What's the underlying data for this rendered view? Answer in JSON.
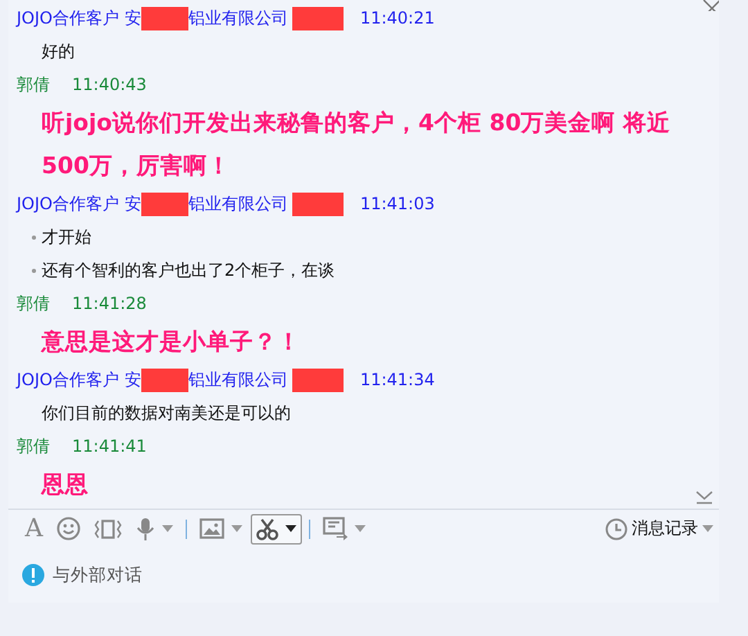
{
  "messages": [
    {
      "kind": "customer",
      "sender": "JOJO合作客户",
      "company_prefix": "安",
      "company_suffix": "铝业有限公司",
      "time": "11:40:21",
      "lines": [
        {
          "text": "好的",
          "bullet": false
        }
      ]
    },
    {
      "kind": "self",
      "sender": "郭倩",
      "time": "11:40:43",
      "lines": [
        {
          "text": "听jojo说你们开发出来秘鲁的客户，4个柜 80万美金啊  将近",
          "bullet": false
        },
        {
          "text": "500万，厉害啊！",
          "bullet": false
        }
      ]
    },
    {
      "kind": "customer",
      "sender": "JOJO合作客户",
      "company_prefix": "安",
      "company_suffix": "铝业有限公司",
      "time": "11:41:03",
      "lines": [
        {
          "text": "才开始",
          "bullet": true
        },
        {
          "text": "还有个智利的客户也出了2个柜子，在谈",
          "bullet": true
        }
      ]
    },
    {
      "kind": "self",
      "sender": "郭倩",
      "time": "11:41:28",
      "lines": [
        {
          "text": "意思是这才是小单子？！",
          "bullet": false
        }
      ]
    },
    {
      "kind": "customer",
      "sender": "JOJO合作客户",
      "company_prefix": "安",
      "company_suffix": "铝业有限公司",
      "time": "11:41:34",
      "lines": [
        {
          "text": "你们目前的数据对南美还是可以的",
          "bullet": false
        }
      ]
    },
    {
      "kind": "self",
      "sender": "郭倩",
      "time": "11:41:41",
      "lines": [
        {
          "text": "恩恩",
          "bullet": false
        }
      ]
    }
  ],
  "toolbar": [
    {
      "kind": "font",
      "label": "A",
      "dropdown": false,
      "selected": false
    },
    {
      "kind": "emoji",
      "dropdown": false,
      "selected": false
    },
    {
      "kind": "shake",
      "dropdown": false,
      "selected": false
    },
    {
      "kind": "voice",
      "dropdown": true,
      "selected": false
    },
    {
      "kind": "image",
      "dropdown": true,
      "selected": false
    },
    {
      "kind": "screenshot",
      "dropdown": true,
      "selected": true
    },
    {
      "kind": "share",
      "dropdown": true,
      "selected": false
    }
  ],
  "history": {
    "label": "消息记录"
  },
  "notice": {
    "text": "与外部对话"
  }
}
